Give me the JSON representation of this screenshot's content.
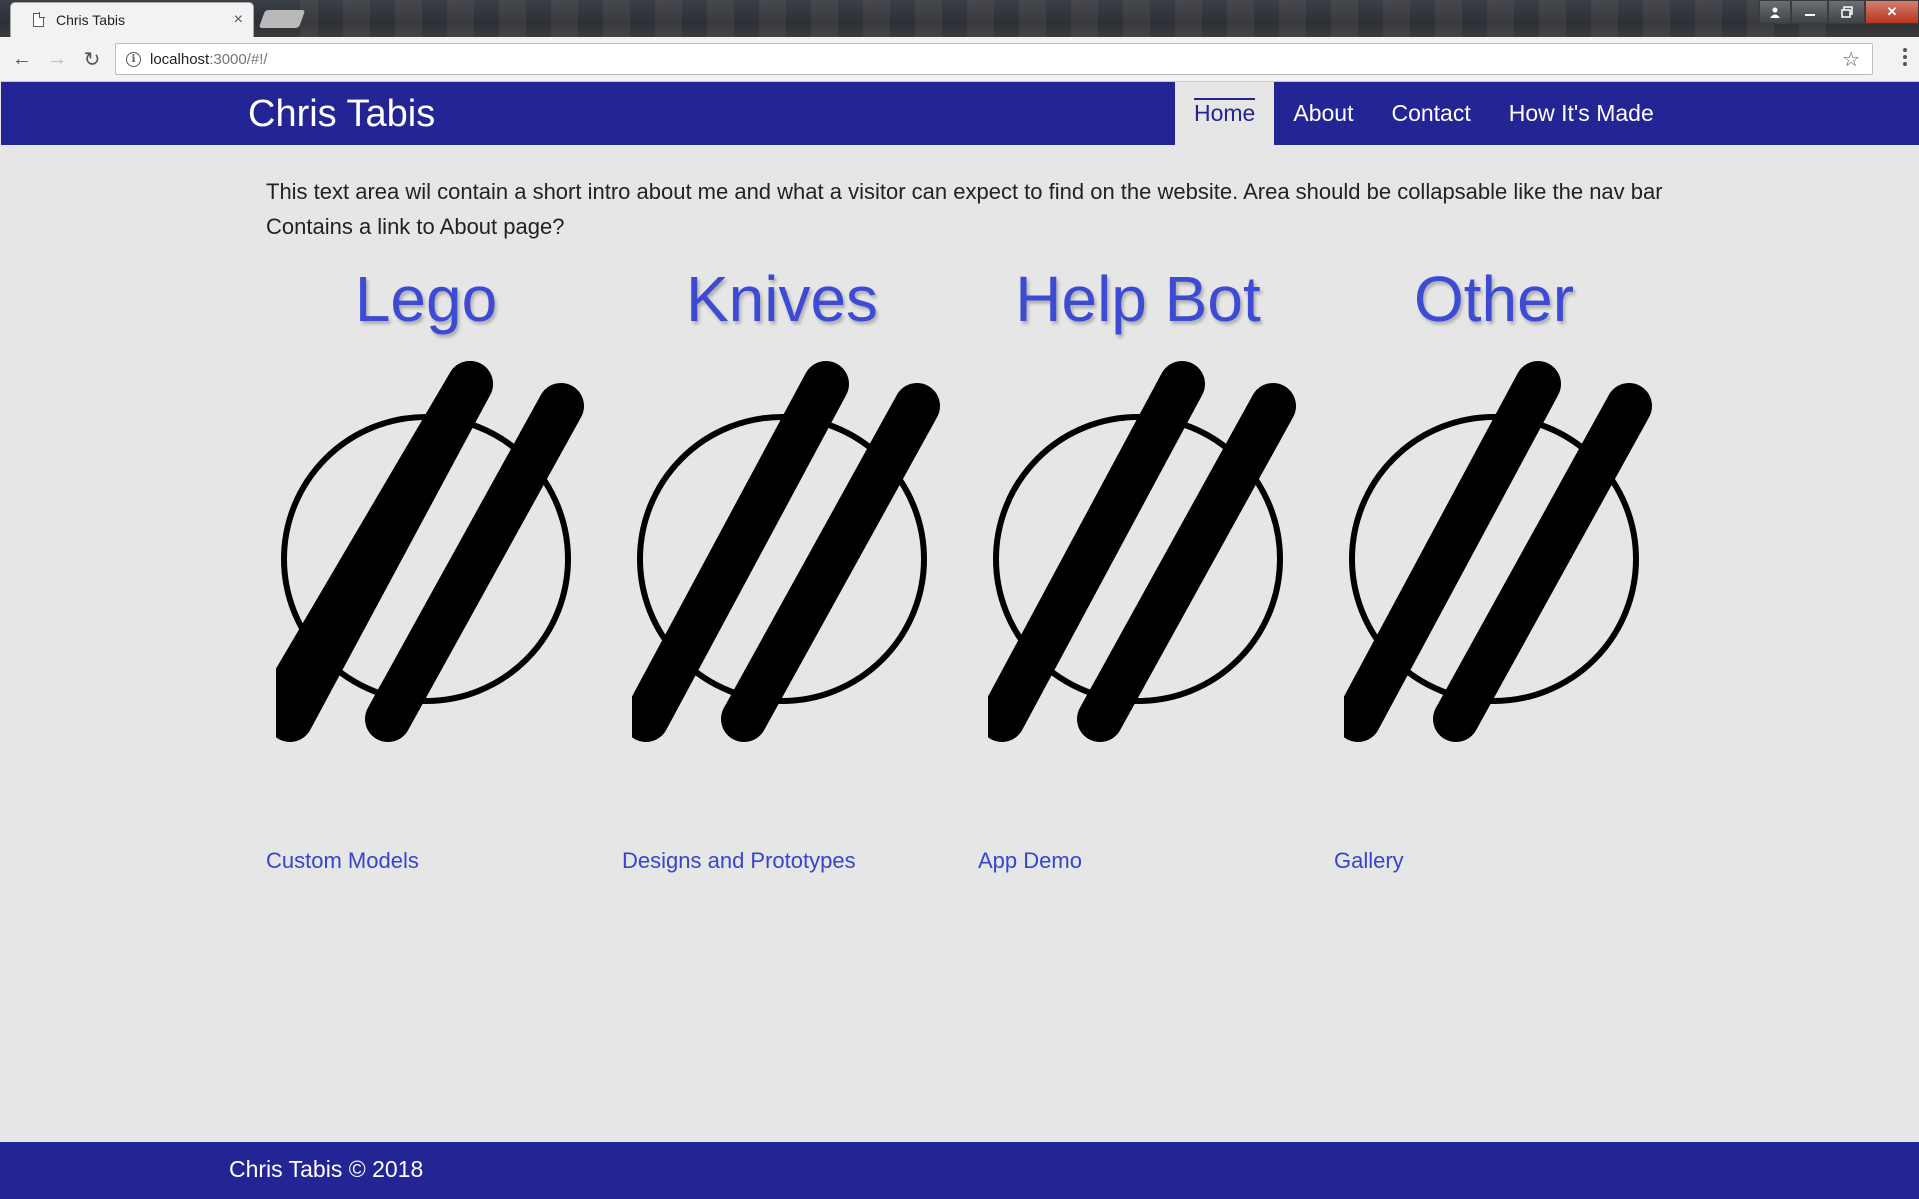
{
  "browser": {
    "tab_title": "Chris Tabis",
    "tab_close": "×",
    "url_host": "localhost",
    "url_rest": ":3000/#!/",
    "info_glyph": "i",
    "star_glyph": "☆",
    "back_glyph": "←",
    "forward_glyph": "→",
    "reload_glyph": "↻",
    "win_min": "▁",
    "win_max": "❐",
    "win_close": "✕",
    "win_user": "👤"
  },
  "site": {
    "brand": "Chris Tabis",
    "nav": [
      {
        "label": "Home",
        "active": true
      },
      {
        "label": "About"
      },
      {
        "label": "Contact"
      },
      {
        "label": "How It's Made"
      }
    ],
    "intro": "This text area wil contain a short intro about me and what a visitor can expect to find on the website. Area should be collapsable like the nav bar Contains a link to About page?",
    "cards": [
      {
        "title": "Lego",
        "link": "Custom Models",
        "icon": "logo-icon"
      },
      {
        "title": "Knives",
        "link": "Designs and Prototypes",
        "icon": "logo-icon"
      },
      {
        "title": "Help Bot",
        "link": "App Demo",
        "icon": "logo-icon"
      },
      {
        "title": "Other",
        "link": "Gallery",
        "icon": "logo-icon"
      }
    ],
    "footer": "Chris Tabis © 2018"
  },
  "colors": {
    "brand_navy": "#232594",
    "page_bg": "#e6e6e6",
    "accent_blue": "#3c4ad4"
  }
}
